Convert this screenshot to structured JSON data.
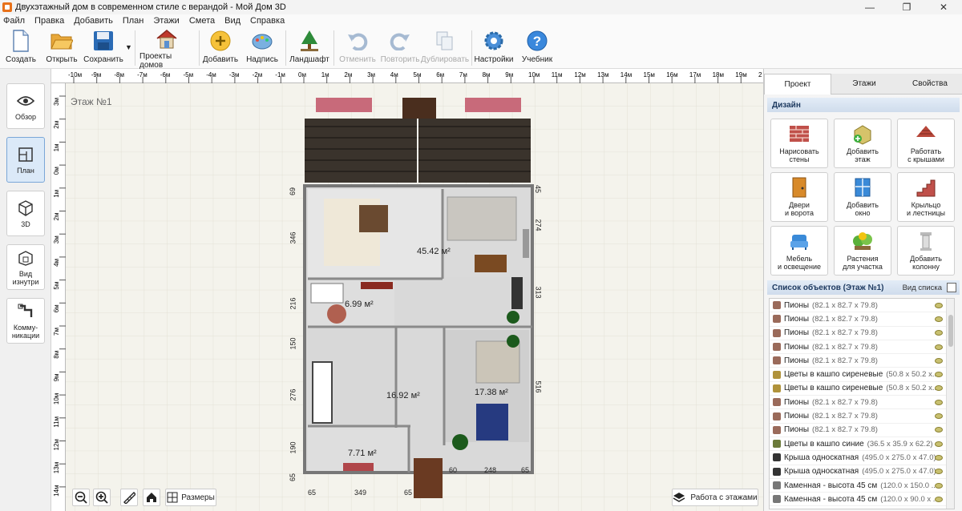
{
  "window": {
    "title": "Двухэтажный дом в современном стиле с верандой - Мой Дом 3D",
    "controls": [
      "—",
      "❐",
      "✕"
    ]
  },
  "menu": [
    "Файл",
    "Правка",
    "Добавить",
    "План",
    "Этажи",
    "Смета",
    "Вид",
    "Справка"
  ],
  "toolbar": {
    "create": "Создать",
    "open": "Открыть",
    "save": "Сохранить",
    "projects": "Проекты домов",
    "add": "Добавить",
    "label": "Надпись",
    "landscape": "Ландшафт",
    "undo": "Отменить",
    "redo": "Повторить",
    "duplicate": "Дублировать",
    "settings": "Настройки",
    "help": "Учебник"
  },
  "left": {
    "overview": "Обзор",
    "plan": "План",
    "view3d": "3D",
    "inside_l1": "Вид",
    "inside_l2": "изнутри",
    "comm_l1": "Комму-",
    "comm_l2": "никации"
  },
  "canvas": {
    "floor_label": "Этаж №1",
    "ruler_top": [
      "-10м",
      "-9м",
      "-8м",
      "-7м",
      "-6м",
      "-5м",
      "-4м",
      "-3м",
      "-2м",
      "-1м",
      "0м",
      "1м",
      "2м",
      "3м",
      "4м",
      "5м",
      "6м",
      "7м",
      "8м",
      "9м",
      "10м",
      "11м",
      "12м",
      "13м",
      "14м",
      "15м",
      "16м",
      "17м",
      "18м",
      "19м",
      "2"
    ],
    "ruler_left": [
      "3м",
      "2м",
      "1м",
      "0м",
      "1м",
      "2м",
      "3м",
      "4м",
      "5м",
      "6м",
      "7м",
      "8м",
      "9м",
      "10м",
      "11м",
      "12м",
      "13м",
      "14м"
    ],
    "rooms": {
      "living": "45.42 м²",
      "bath": "6.99 м²",
      "hall": "16.92 м²",
      "bedroom": "17.38 м²",
      "entry": "7.71 м²"
    },
    "dims_left": [
      "69",
      "346",
      "216",
      "150",
      "276",
      "190",
      "65"
    ],
    "dims_right": [
      "45",
      "274",
      "313",
      "516"
    ],
    "dims_bottom": [
      "65",
      "349",
      "65",
      "60",
      "248",
      "65"
    ],
    "sizes_btn": "Размеры",
    "floors_btn": "Работа с этажами"
  },
  "right": {
    "tabs": [
      "Проект",
      "Этажи",
      "Свойства"
    ],
    "design_title": "Дизайн",
    "design": [
      {
        "l1": "Нарисовать",
        "l2": "стены"
      },
      {
        "l1": "Добавить",
        "l2": "этаж"
      },
      {
        "l1": "Работать",
        "l2": "с крышами"
      },
      {
        "l1": "Двери",
        "l2": "и ворота"
      },
      {
        "l1": "Добавить",
        "l2": "окно"
      },
      {
        "l1": "Крыльцо",
        "l2": "и лестницы"
      },
      {
        "l1": "Мебель",
        "l2": "и освещение"
      },
      {
        "l1": "Растения",
        "l2": "для участка"
      },
      {
        "l1": "Добавить",
        "l2": "колонну"
      }
    ],
    "list_title": "Список объектов (Этаж №1)",
    "list_view": "Вид списка",
    "objects": [
      {
        "name": "Пионы",
        "dim": "(82.1 x 82.7 x 79.8)",
        "color": "#9a6a5a"
      },
      {
        "name": "Пионы",
        "dim": "(82.1 x 82.7 x 79.8)",
        "color": "#9a6a5a"
      },
      {
        "name": "Пионы",
        "dim": "(82.1 x 82.7 x 79.8)",
        "color": "#9a6a5a"
      },
      {
        "name": "Пионы",
        "dim": "(82.1 x 82.7 x 79.8)",
        "color": "#9a6a5a"
      },
      {
        "name": "Пионы",
        "dim": "(82.1 x 82.7 x 79.8)",
        "color": "#9a6a5a"
      },
      {
        "name": "Цветы в кашпо сиреневые",
        "dim": "(50.8 x 50.2 x...",
        "color": "#b0923a"
      },
      {
        "name": "Цветы в кашпо сиреневые",
        "dim": "(50.8 x 50.2 x...",
        "color": "#b0923a"
      },
      {
        "name": "Пионы",
        "dim": "(82.1 x 82.7 x 79.8)",
        "color": "#9a6a5a"
      },
      {
        "name": "Пионы",
        "dim": "(82.1 x 82.7 x 79.8)",
        "color": "#9a6a5a"
      },
      {
        "name": "Пионы",
        "dim": "(82.1 x 82.7 x 79.8)",
        "color": "#9a6a5a"
      },
      {
        "name": "Цветы в кашпо синие",
        "dim": "(36.5 x 35.9 x 62.2)",
        "color": "#6b7a3a"
      },
      {
        "name": "Крыша односкатная",
        "dim": "(495.0 x 275.0 x 47.0)",
        "color": "#333333"
      },
      {
        "name": "Крыша односкатная",
        "dim": "(495.0 x 275.0 x 47.0)",
        "color": "#333333"
      },
      {
        "name": "Каменная - высота 45 см",
        "dim": "(120.0 x 150.0 ...",
        "color": "#777777"
      },
      {
        "name": "Каменная - высота 45 см",
        "dim": "(120.0 x 90.0 x ...",
        "color": "#777777"
      }
    ]
  }
}
